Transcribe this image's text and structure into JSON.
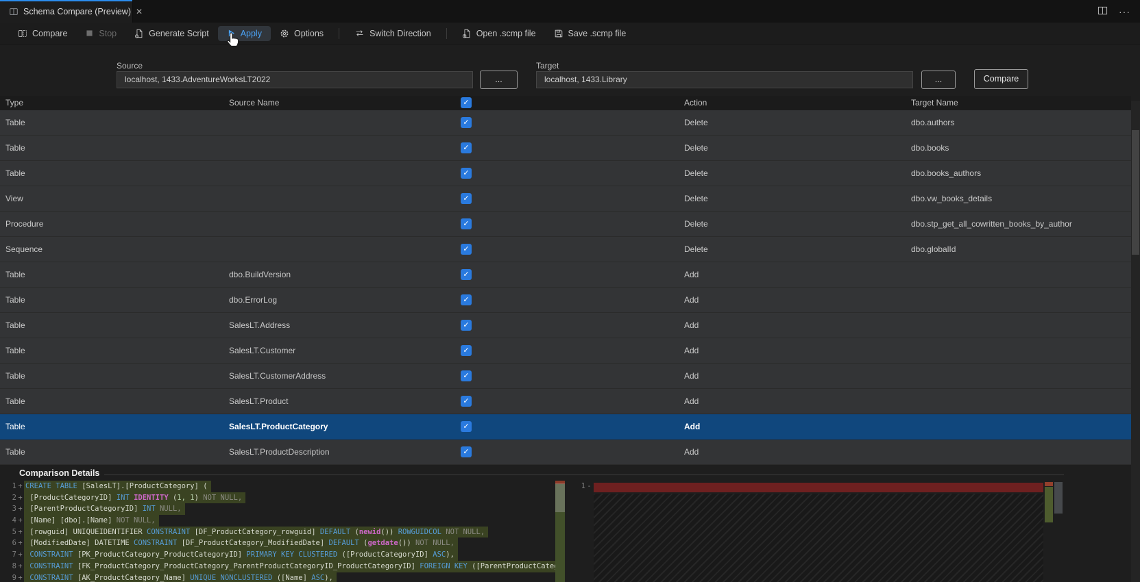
{
  "tab": {
    "title": "Schema Compare (Preview)",
    "close_glyph": "✕",
    "more_glyph": "···"
  },
  "toolbar": {
    "items": [
      {
        "id": "compare",
        "label": "Compare",
        "icon": "compare"
      },
      {
        "id": "stop",
        "label": "Stop",
        "icon": "stop",
        "disabled": true
      },
      {
        "id": "generate-script",
        "label": "Generate Script",
        "icon": "script"
      },
      {
        "id": "apply",
        "label": "Apply",
        "icon": "play",
        "active": true
      },
      {
        "id": "options",
        "label": "Options",
        "icon": "gear"
      },
      {
        "divider": true
      },
      {
        "id": "switch-direction",
        "label": "Switch Direction",
        "icon": "swap"
      },
      {
        "divider": true
      },
      {
        "id": "open-scmp-file",
        "label": "Open .scmp file",
        "icon": "open-file"
      },
      {
        "id": "save-scmp-file",
        "label": "Save .scmp file",
        "icon": "save"
      }
    ]
  },
  "connections": {
    "source_label": "Source",
    "source_value": "localhost, 1433.AdventureWorksLT2022",
    "target_label": "Target",
    "target_value": "localhost, 1433.Library",
    "browse_label": "...",
    "compare_button": "Compare"
  },
  "grid": {
    "columns": [
      "Type",
      "Source Name",
      "Action",
      "Target Name"
    ],
    "rows": [
      {
        "type": "Table",
        "source": "",
        "checked": true,
        "action": "Delete",
        "target": "dbo.authors"
      },
      {
        "type": "Table",
        "source": "",
        "checked": true,
        "action": "Delete",
        "target": "dbo.books"
      },
      {
        "type": "Table",
        "source": "",
        "checked": true,
        "action": "Delete",
        "target": "dbo.books_authors"
      },
      {
        "type": "View",
        "source": "",
        "checked": true,
        "action": "Delete",
        "target": "dbo.vw_books_details"
      },
      {
        "type": "Procedure",
        "source": "",
        "checked": true,
        "action": "Delete",
        "target": "dbo.stp_get_all_cowritten_books_by_author"
      },
      {
        "type": "Sequence",
        "source": "",
        "checked": true,
        "action": "Delete",
        "target": "dbo.globalId"
      },
      {
        "type": "Table",
        "source": "dbo.BuildVersion",
        "checked": true,
        "action": "Add",
        "target": ""
      },
      {
        "type": "Table",
        "source": "dbo.ErrorLog",
        "checked": true,
        "action": "Add",
        "target": ""
      },
      {
        "type": "Table",
        "source": "SalesLT.Address",
        "checked": true,
        "action": "Add",
        "target": ""
      },
      {
        "type": "Table",
        "source": "SalesLT.Customer",
        "checked": true,
        "action": "Add",
        "target": ""
      },
      {
        "type": "Table",
        "source": "SalesLT.CustomerAddress",
        "checked": true,
        "action": "Add",
        "target": ""
      },
      {
        "type": "Table",
        "source": "SalesLT.Product",
        "checked": true,
        "action": "Add",
        "target": ""
      },
      {
        "type": "Table",
        "source": "SalesLT.ProductCategory",
        "checked": true,
        "action": "Add",
        "target": "",
        "selected": true
      },
      {
        "type": "Table",
        "source": "SalesLT.ProductDescription",
        "checked": true,
        "action": "Add",
        "target": ""
      }
    ]
  },
  "details": {
    "title": "Comparison Details",
    "left_lines": [
      {
        "num": "1",
        "mark": "+",
        "segs": [
          [
            "k",
            "CREATE TABLE "
          ],
          [
            "t",
            "[SalesLT].[ProductCategory] ("
          ]
        ]
      },
      {
        "num": "2",
        "mark": "+",
        "segs": [
          [
            "t",
            " [ProductCategoryID] "
          ],
          [
            "k",
            "INT "
          ],
          [
            "m",
            "IDENTITY "
          ],
          [
            "t",
            "("
          ],
          [
            "n",
            "1, 1"
          ],
          [
            "t",
            ") "
          ],
          [
            "g",
            "NOT NULL,"
          ]
        ]
      },
      {
        "num": "3",
        "mark": "+",
        "segs": [
          [
            "t",
            " [ParentProductCategoryID] "
          ],
          [
            "k",
            "INT "
          ],
          [
            "g",
            "NULL,"
          ]
        ]
      },
      {
        "num": "4",
        "mark": "+",
        "segs": [
          [
            "t",
            " [Name] [dbo].[Name] "
          ],
          [
            "g",
            "NOT NULL,"
          ]
        ]
      },
      {
        "num": "5",
        "mark": "+",
        "segs": [
          [
            "t",
            " [rowguid] UNIQUEIDENTIFIER "
          ],
          [
            "k",
            "CONSTRAINT "
          ],
          [
            "t",
            "[DF_ProductCategory_rowguid] "
          ],
          [
            "k",
            "DEFAULT "
          ],
          [
            "t",
            "("
          ],
          [
            "m",
            "newid"
          ],
          [
            "t",
            "()) "
          ],
          [
            "k",
            "ROWGUIDCOL "
          ],
          [
            "g",
            "NOT NULL,"
          ]
        ]
      },
      {
        "num": "6",
        "mark": "+",
        "segs": [
          [
            "t",
            " [ModifiedDate] DATETIME "
          ],
          [
            "k",
            "CONSTRAINT "
          ],
          [
            "t",
            "[DF_ProductCategory_ModifiedDate] "
          ],
          [
            "k",
            "DEFAULT "
          ],
          [
            "t",
            "("
          ],
          [
            "m",
            "getdate"
          ],
          [
            "t",
            "()) "
          ],
          [
            "g",
            "NOT NULL,"
          ]
        ]
      },
      {
        "num": "7",
        "mark": "+",
        "segs": [
          [
            "t",
            " "
          ],
          [
            "k",
            "CONSTRAINT "
          ],
          [
            "t",
            "[PK_ProductCategory_ProductCategoryID] "
          ],
          [
            "k",
            "PRIMARY KEY CLUSTERED "
          ],
          [
            "t",
            "([ProductCategoryID] "
          ],
          [
            "k",
            "ASC"
          ],
          [
            "t",
            "),"
          ]
        ]
      },
      {
        "num": "8",
        "mark": "+",
        "segs": [
          [
            "t",
            " "
          ],
          [
            "k",
            "CONSTRAINT "
          ],
          [
            "t",
            "[FK_ProductCategory_ProductCategory_ParentProductCategoryID_ProductCategoryID] "
          ],
          [
            "k",
            "FOREIGN KEY "
          ],
          [
            "t",
            "([ParentProductCatego"
          ]
        ]
      },
      {
        "num": "9",
        "mark": "+",
        "segs": [
          [
            "t",
            " "
          ],
          [
            "k",
            "CONSTRAINT "
          ],
          [
            "t",
            "[AK_ProductCategory_Name] "
          ],
          [
            "k",
            "UNIQUE NONCLUSTERED "
          ],
          [
            "t",
            "([Name] "
          ],
          [
            "k",
            "ASC"
          ],
          [
            "t",
            "),"
          ]
        ]
      }
    ],
    "right_lines": [
      {
        "num": "1",
        "mark": "-"
      }
    ]
  },
  "icons": {
    "check": "✓",
    "scroll_up": "▲"
  },
  "colors": {
    "accent_blue": "#2b8ced",
    "apply_blue": "#4ba3f5",
    "checkbox_blue": "#2a7ade",
    "selected_row": "#10477d",
    "added_line_bg": "#3a4322",
    "removed_line_bg": "#6e2020",
    "keyword": "#569cd6",
    "function_magenta": "#cd68c8",
    "number_green": "#b5cea8",
    "muted_gray": "#8b8b83"
  }
}
